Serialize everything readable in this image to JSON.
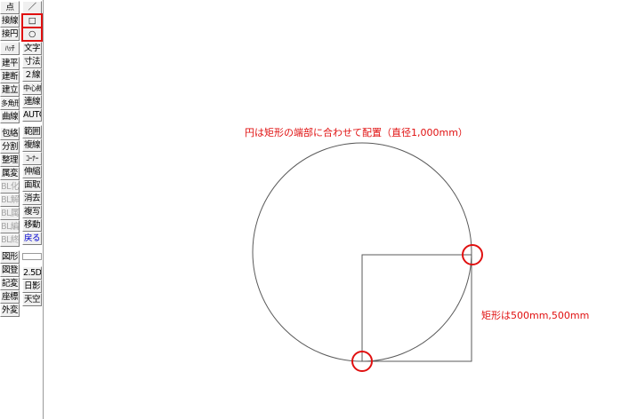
{
  "toolbar": {
    "col1": {
      "point": "点",
      "tangent_line": "接線",
      "tangent_circle": "接円",
      "hatch": "ﾊｯﾁ",
      "architect_plan": "建平",
      "architect_section": "建断",
      "architect_elevation": "建立",
      "polygon": "多角形",
      "curve": "曲線",
      "wrap": "包絡",
      "split": "分割",
      "arrange": "整理",
      "attribute_change": "属変",
      "bl_make": "BL化",
      "bl_release": "BL解",
      "bl_attribute": "BL属",
      "bl_edit": "BL編",
      "bl_end": "BL終",
      "figure": "図形",
      "figure_register": "図登",
      "symbol_change": "記変",
      "coordinate": "座標",
      "external_change": "外変"
    },
    "col2": {
      "line": "／",
      "rectangle": "□",
      "circle": "○",
      "text": "文字",
      "dimension": "寸法",
      "double_line": "２線",
      "center_line": "中心線",
      "continuous_line": "連線",
      "auto": "AUTO",
      "range": "範囲",
      "copy_line": "複線",
      "corner": "ｺｰﾅｰ",
      "stretch": "伸縮",
      "chamfer": "面取",
      "erase": "消去",
      "copy": "複写",
      "move": "移動",
      "back": "戻る",
      "view_2_5d": "2.5D",
      "sun_shadow": "日影",
      "sky": "天空"
    }
  },
  "annotations": {
    "circle_note": "円は矩形の端部に合わせて配置（直径1,000mm）",
    "rect_note": "矩形は500mm,500mm"
  },
  "colors": {
    "annotation": "#e01010",
    "disabled_text": "#a6a6a6",
    "back_text": "#0000d0",
    "drawing_line": "#5a5a5a"
  }
}
